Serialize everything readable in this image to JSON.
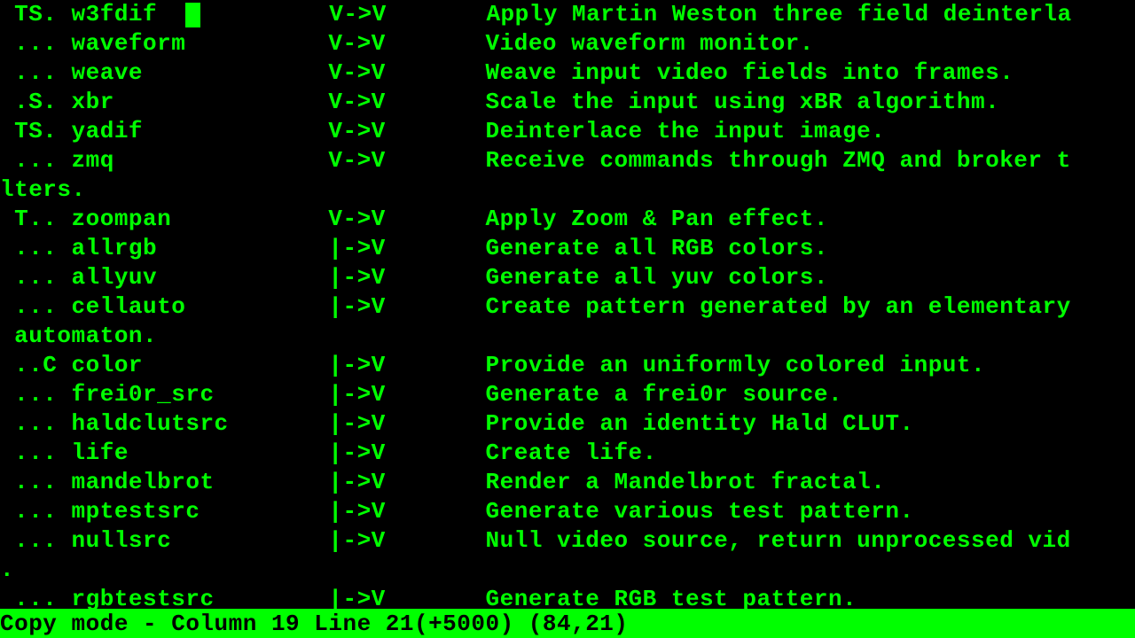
{
  "rows": [
    {
      "flags": " TS. ",
      "name": "w3fdif",
      "cursor": true,
      "mapping": "V->V",
      "desc": "Apply Martin Weston three field deinterla"
    },
    {
      "flags": " ... ",
      "name": "waveform",
      "mapping": "V->V",
      "desc": "Video waveform monitor."
    },
    {
      "flags": " ... ",
      "name": "weave",
      "mapping": "V->V",
      "desc": "Weave input video fields into frames."
    },
    {
      "flags": " .S. ",
      "name": "xbr",
      "mapping": "V->V",
      "desc": "Scale the input using xBR algorithm."
    },
    {
      "flags": " TS. ",
      "name": "yadif",
      "mapping": "V->V",
      "desc": "Deinterlace the input image."
    },
    {
      "flags": " ... ",
      "name": "zmq",
      "mapping": "V->V",
      "desc": "Receive commands through ZMQ and broker t"
    },
    {
      "wrap": "lters."
    },
    {
      "flags": " T.. ",
      "name": "zoompan",
      "mapping": "V->V",
      "desc": "Apply Zoom & Pan effect."
    },
    {
      "flags": " ... ",
      "name": "allrgb",
      "mapping": "|->V",
      "desc": "Generate all RGB colors."
    },
    {
      "flags": " ... ",
      "name": "allyuv",
      "mapping": "|->V",
      "desc": "Generate all yuv colors."
    },
    {
      "flags": " ... ",
      "name": "cellauto",
      "mapping": "|->V",
      "desc": "Create pattern generated by an elementary"
    },
    {
      "wrap": " automaton."
    },
    {
      "flags": " ..C ",
      "name": "color",
      "mapping": "|->V",
      "desc": "Provide an uniformly colored input."
    },
    {
      "flags": " ... ",
      "name": "frei0r_src",
      "mapping": "|->V",
      "desc": "Generate a frei0r source."
    },
    {
      "flags": " ... ",
      "name": "haldclutsrc",
      "mapping": "|->V",
      "desc": "Provide an identity Hald CLUT."
    },
    {
      "flags": " ... ",
      "name": "life",
      "mapping": "|->V",
      "desc": "Create life."
    },
    {
      "flags": " ... ",
      "name": "mandelbrot",
      "mapping": "|->V",
      "desc": "Render a Mandelbrot fractal."
    },
    {
      "flags": " ... ",
      "name": "mptestsrc",
      "mapping": "|->V",
      "desc": "Generate various test pattern."
    },
    {
      "flags": " ... ",
      "name": "nullsrc",
      "mapping": "|->V",
      "desc": "Null video source, return unprocessed vid"
    },
    {
      "wrap": "."
    },
    {
      "flags": " ... ",
      "name": "rgbtestsrc",
      "mapping": "|->V",
      "desc": "Generate RGB test pattern."
    }
  ],
  "columns": {
    "name_width": 18,
    "mapping_width": 11
  },
  "status": "Copy mode - Column 19 Line 21(+5000) (84,21)"
}
